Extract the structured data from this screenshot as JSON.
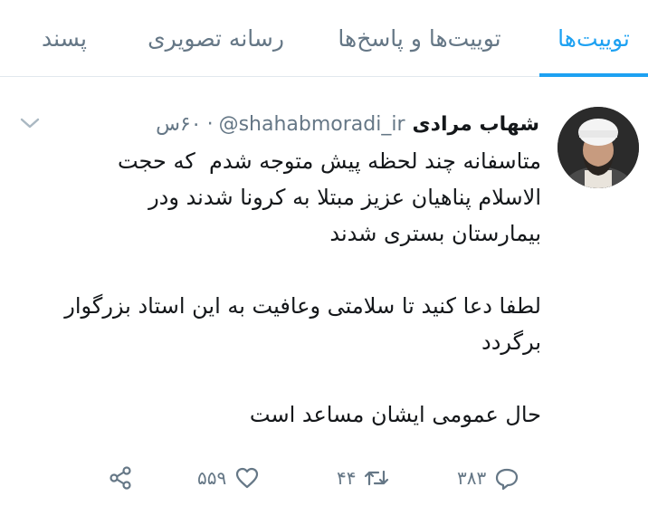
{
  "tabs": [
    {
      "label": "توییت‌ها",
      "active": true
    },
    {
      "label": "توییت‌ها و پاسخ‌ها",
      "active": false
    },
    {
      "label": "رسانه تصویری",
      "active": false
    },
    {
      "label": "پسند",
      "active": false
    }
  ],
  "tweet": {
    "name": "شهاب مرادی",
    "handle": "@shahabmoradi_ir",
    "separator": "·",
    "time": "۶۰س",
    "body": "متاسفانه چند لحظه پیش متوجه شدم  که حجت\nالاسلام پناهیان عزیز مبتلا به کرونا شدند ودر\nبیمارستان بستری شدند\n\nلطفا دعا کنید تا سلامتی وعافیت به این استاد بزرگوار\nبرگردد\n\nحال عمومی ایشان مساعد است",
    "reply_count": "۳۸۳",
    "retweet_count": "۴۴",
    "like_count": "۵۵۹"
  },
  "icons": {
    "avatar": "profile-photo",
    "caret": "chevron-down-icon",
    "reply": "reply-icon",
    "retweet": "retweet-icon",
    "like": "heart-icon",
    "share": "share-icon"
  },
  "colors": {
    "accent": "#1da1f2",
    "muted": "#657786",
    "text": "#14171a",
    "divider": "#e1e8ed"
  }
}
